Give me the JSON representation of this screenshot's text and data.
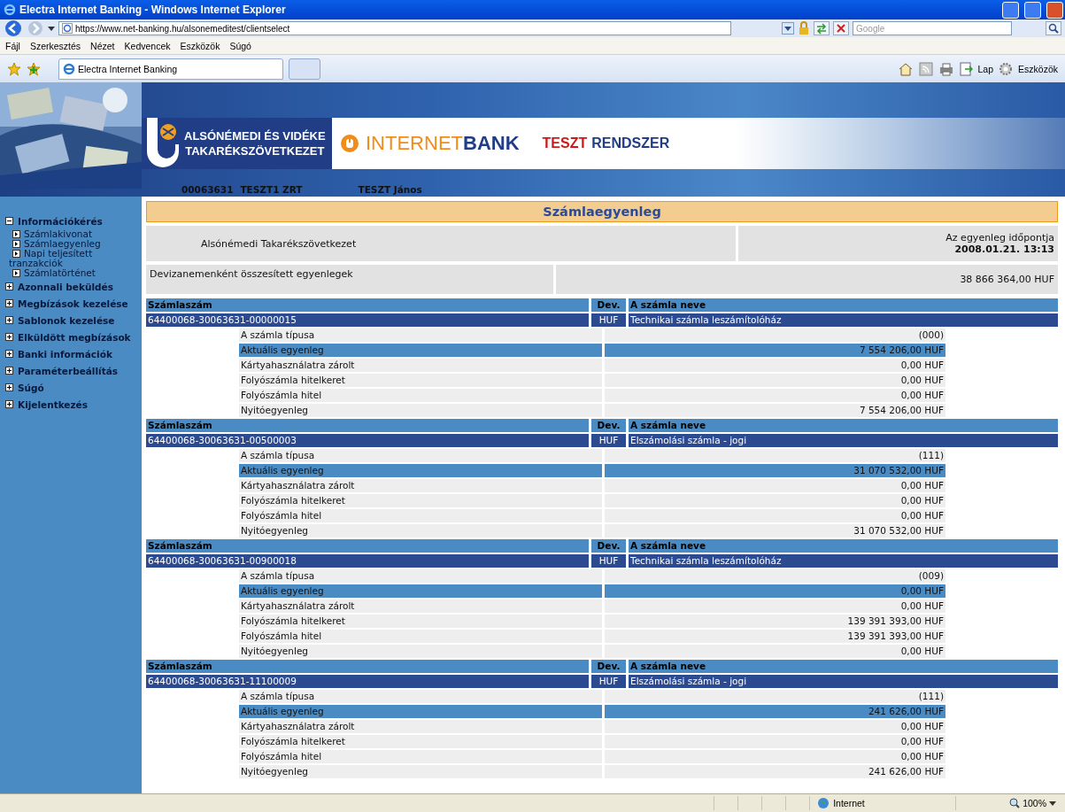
{
  "window": {
    "title": "Electra Internet Banking - Windows Internet Explorer"
  },
  "address_bar": {
    "url": "https://www.net-banking.hu/alsonemeditest/clientselect",
    "search_placeholder": "Google"
  },
  "menu": [
    "Fájl",
    "Szerkesztés",
    "Nézet",
    "Kedvencek",
    "Eszközök",
    "Súgó"
  ],
  "tabs": [
    {
      "label": "Electra Internet Banking",
      "selected": true
    }
  ],
  "command_bar": [
    "Lap",
    "Eszközök"
  ],
  "header": {
    "bank_name_line_1": "ALSÓNÉMEDI ÉS VIDÉKE",
    "bank_name_line_2": "TAKARÉKSZÖVETKEZET",
    "product_part_1": "INTERNET",
    "product_part_2": "BANK",
    "system_part_1": "TESZT",
    "system_part_2": "RENDSZER",
    "client_id": "00063631",
    "client_name": "TESZT1 ZRT",
    "user_name": "TESZT János"
  },
  "sidebar": {
    "items": [
      {
        "label": "Információkérés",
        "expanded": true,
        "children": [
          {
            "label": "Számlakivonat"
          },
          {
            "label": "Számlaegyenleg"
          },
          {
            "label": "Napi teljesített tranzakciók"
          },
          {
            "label": "Számlatörténet"
          }
        ]
      },
      {
        "label": "Azonnali beküldés",
        "expanded": false
      },
      {
        "label": "Megbízások kezelése",
        "expanded": false
      },
      {
        "label": "Sablonok kezelése",
        "expanded": false
      },
      {
        "label": "Elküldött megbízások",
        "expanded": false
      },
      {
        "label": "Banki információk",
        "expanded": false
      },
      {
        "label": "Paraméterbeállítás",
        "expanded": false
      },
      {
        "label": "Súgó",
        "expanded": false
      },
      {
        "label": "Kijelentkezés",
        "expanded": false
      }
    ]
  },
  "page": {
    "title": "Számlaegyenleg",
    "institution": "Alsónémedi Takarékszövetkezet",
    "balance_time_label": "Az egyenleg időpontja",
    "balance_time": "2008.01.21. 13:13",
    "summary_label": "Devizanemenként összesített egyenlegek",
    "summary_value": "38 866 364,00 HUF"
  },
  "accounts": [
    {
      "col_number": "Számlaszám",
      "col_currency": "Dev.",
      "col_name": "A számla neve",
      "number": "64400068-30063631-00000015",
      "currency": "HUF",
      "name": "Technikai számla leszámítolóház",
      "rows": [
        {
          "label": "A számla típusa",
          "value": "(000)",
          "highlighted": false
        },
        {
          "label": "Aktuális egyenleg",
          "value": "7 554 206,00 HUF",
          "highlighted": true
        },
        {
          "label": "Kártyahasználatra zárolt",
          "value": "0,00 HUF",
          "highlighted": false
        },
        {
          "label": "Folyószámla hitelkeret",
          "value": "0,00 HUF",
          "highlighted": false
        },
        {
          "label": "Folyószámla hitel",
          "value": "0,00 HUF",
          "highlighted": false
        },
        {
          "label": "Nyitóegyenleg",
          "value": "7 554 206,00 HUF",
          "highlighted": false
        }
      ]
    },
    {
      "col_number": "Számlaszám",
      "col_currency": "Dev.",
      "col_name": "A számla neve",
      "number": "64400068-30063631-00500003",
      "currency": "HUF",
      "name": "Elszámolási számla - jogi",
      "rows": [
        {
          "label": "A számla típusa",
          "value": "(111)",
          "highlighted": false
        },
        {
          "label": "Aktuális egyenleg",
          "value": "31 070 532,00 HUF",
          "highlighted": true
        },
        {
          "label": "Kártyahasználatra zárolt",
          "value": "0,00 HUF",
          "highlighted": false
        },
        {
          "label": "Folyószámla hitelkeret",
          "value": "0,00 HUF",
          "highlighted": false
        },
        {
          "label": "Folyószámla hitel",
          "value": "0,00 HUF",
          "highlighted": false
        },
        {
          "label": "Nyitóegyenleg",
          "value": "31 070 532,00 HUF",
          "highlighted": false
        }
      ]
    },
    {
      "col_number": "Számlaszám",
      "col_currency": "Dev.",
      "col_name": "A számla neve",
      "number": "64400068-30063631-00900018",
      "currency": "HUF",
      "name": "Technikai számla leszámítolóház",
      "rows": [
        {
          "label": "A számla típusa",
          "value": "(009)",
          "highlighted": false
        },
        {
          "label": "Aktuális egyenleg",
          "value": "0,00 HUF",
          "highlighted": true
        },
        {
          "label": "Kártyahasználatra zárolt",
          "value": "0,00 HUF",
          "highlighted": false
        },
        {
          "label": "Folyószámla hitelkeret",
          "value": "139 391 393,00 HUF",
          "highlighted": false
        },
        {
          "label": "Folyószámla hitel",
          "value": "139 391 393,00 HUF",
          "highlighted": false
        },
        {
          "label": "Nyitóegyenleg",
          "value": "0,00 HUF",
          "highlighted": false
        }
      ]
    },
    {
      "col_number": "Számlaszám",
      "col_currency": "Dev.",
      "col_name": "A számla neve",
      "number": "64400068-30063631-11100009",
      "currency": "HUF",
      "name": "Elszámolási számla - jogi",
      "rows": [
        {
          "label": "A számla típusa",
          "value": "(111)",
          "highlighted": false
        },
        {
          "label": "Aktuális egyenleg",
          "value": "241 626,00 HUF",
          "highlighted": true
        },
        {
          "label": "Kártyahasználatra zárolt",
          "value": "0,00 HUF",
          "highlighted": false
        },
        {
          "label": "Folyószámla hitelkeret",
          "value": "0,00 HUF",
          "highlighted": false
        },
        {
          "label": "Folyószámla hitel",
          "value": "0,00 HUF",
          "highlighted": false
        },
        {
          "label": "Nyitóegyenleg",
          "value": "241 626,00 HUF",
          "highlighted": false
        }
      ]
    }
  ],
  "status_bar": {
    "zone": "Internet",
    "zoom": "100%"
  }
}
